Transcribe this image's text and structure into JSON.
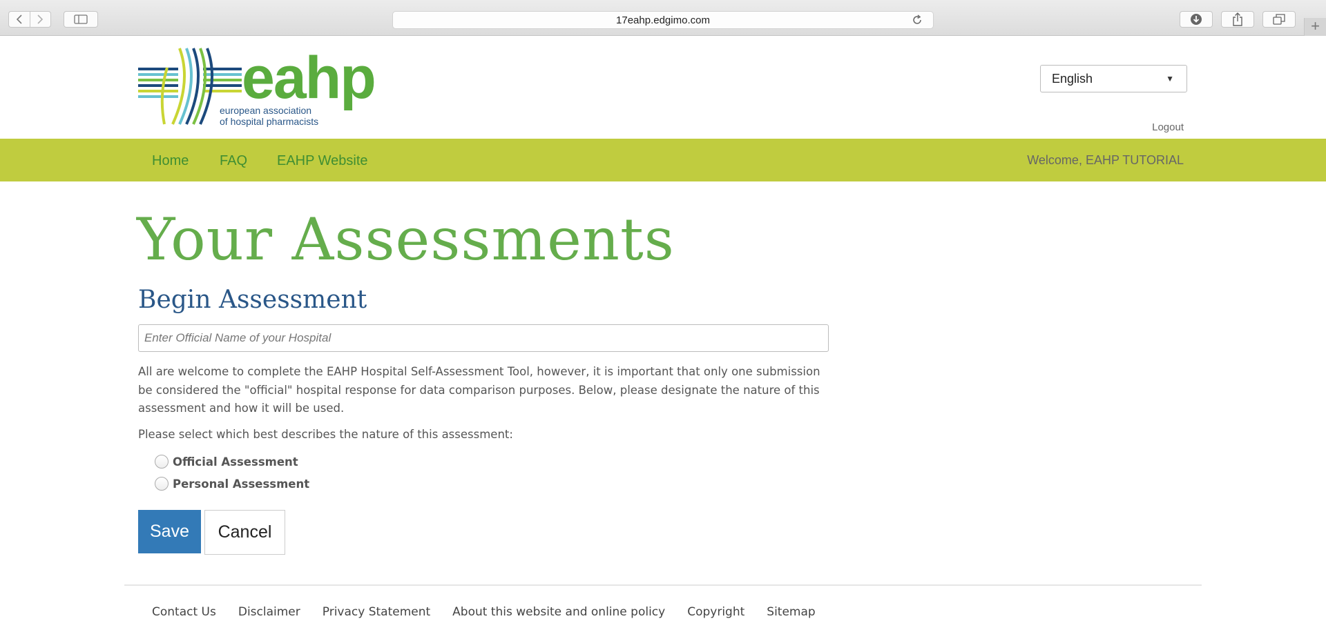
{
  "browser": {
    "url": "17eahp.edgimo.com",
    "new_tab": "+"
  },
  "header": {
    "logo_alt": "eahp",
    "logo_tagline_1": "european association",
    "logo_tagline_2": "of hospital pharmacists",
    "language_selected": "English",
    "logout_label": "Logout"
  },
  "nav": {
    "items": [
      {
        "label": "Home"
      },
      {
        "label": "FAQ"
      },
      {
        "label": "EAHP Website"
      }
    ],
    "welcome": "Welcome, EAHP TUTORIAL"
  },
  "main": {
    "title": "Your Assessments",
    "section_title": "Begin Assessment",
    "hospital_placeholder": "Enter Official Name of your Hospital",
    "intro": "All are welcome to complete the EAHP Hospital Self-Assessment Tool, however, it is important that only one submission be considered the \"official\" hospital response for data comparison purposes. Below, please designate the nature of this assessment and how it will be used.",
    "prompt": "Please select which best describes the nature of this assessment:",
    "options": [
      {
        "label": "Official Assessment"
      },
      {
        "label": "Personal Assessment"
      }
    ],
    "save_label": "Save",
    "cancel_label": "Cancel"
  },
  "footer": {
    "links": [
      {
        "label": "Contact Us"
      },
      {
        "label": "Disclaimer"
      },
      {
        "label": "Privacy Statement"
      },
      {
        "label": "About this website and online policy"
      },
      {
        "label": "Copyright"
      },
      {
        "label": "Sitemap"
      }
    ]
  },
  "colors": {
    "brand_green": "#65ad4c",
    "nav_bar": "#c0cc3f",
    "heading_blue": "#2a5788",
    "primary_button": "#337ab7"
  }
}
